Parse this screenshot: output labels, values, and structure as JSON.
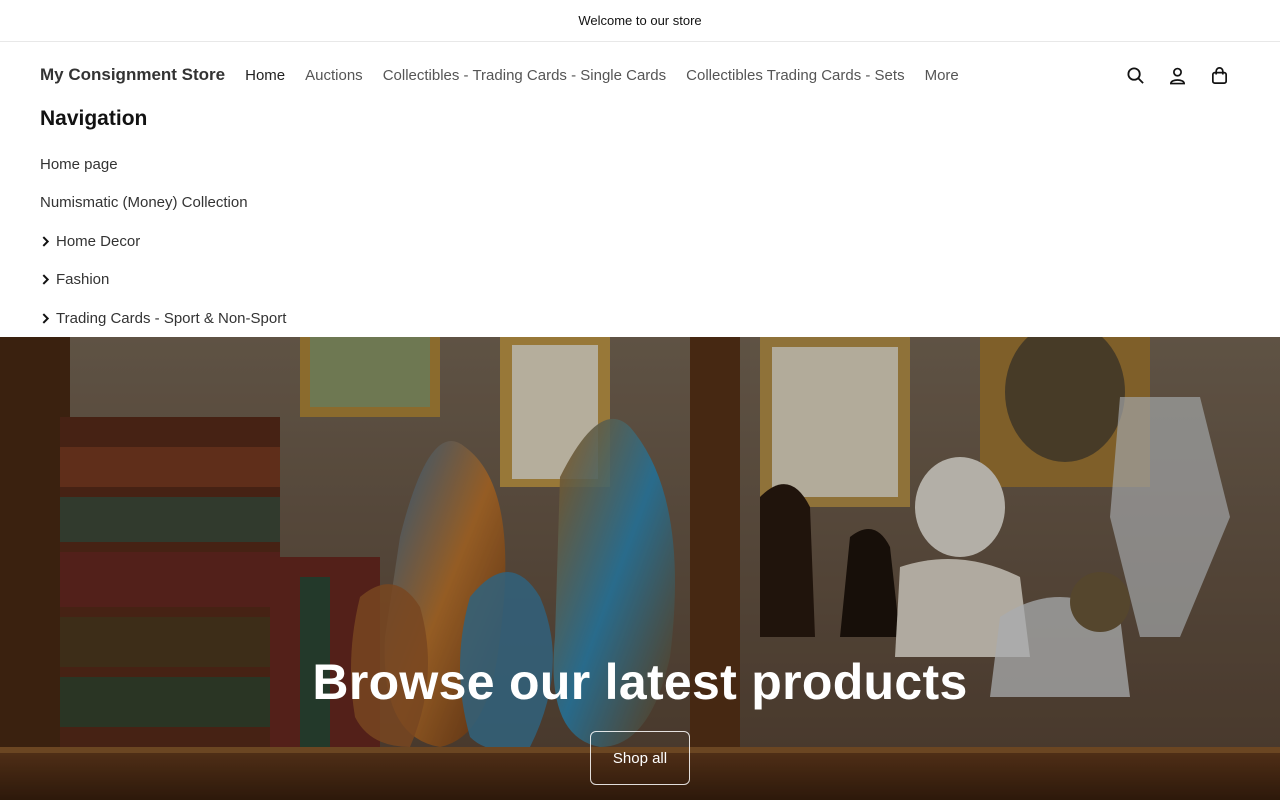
{
  "announcement": {
    "text": "Welcome to our store"
  },
  "header": {
    "logo": "My Consignment Store",
    "nav": [
      {
        "label": "Home"
      },
      {
        "label": "Auctions"
      },
      {
        "label": "Collectibles - Trading Cards - Single Cards"
      },
      {
        "label": "Collectibles Trading Cards - Sets"
      },
      {
        "label": "More"
      }
    ],
    "icons": [
      "search-icon",
      "account-icon",
      "cart-icon"
    ]
  },
  "menu": {
    "title": "Navigation",
    "items": [
      {
        "label": "Home page",
        "has_children": false
      },
      {
        "label": "Numismatic (Money) Collection",
        "has_children": false
      },
      {
        "label": "Home Decor",
        "has_children": true
      },
      {
        "label": "Fashion",
        "has_children": true
      },
      {
        "label": "Trading Cards - Sport & Non-Sport",
        "has_children": true
      }
    ]
  },
  "hero": {
    "title": "Browse our latest products",
    "button": "Shop all"
  },
  "colors": {
    "text": "#121212",
    "nav_text": "#555555",
    "hero_bg": "#4a3526"
  }
}
